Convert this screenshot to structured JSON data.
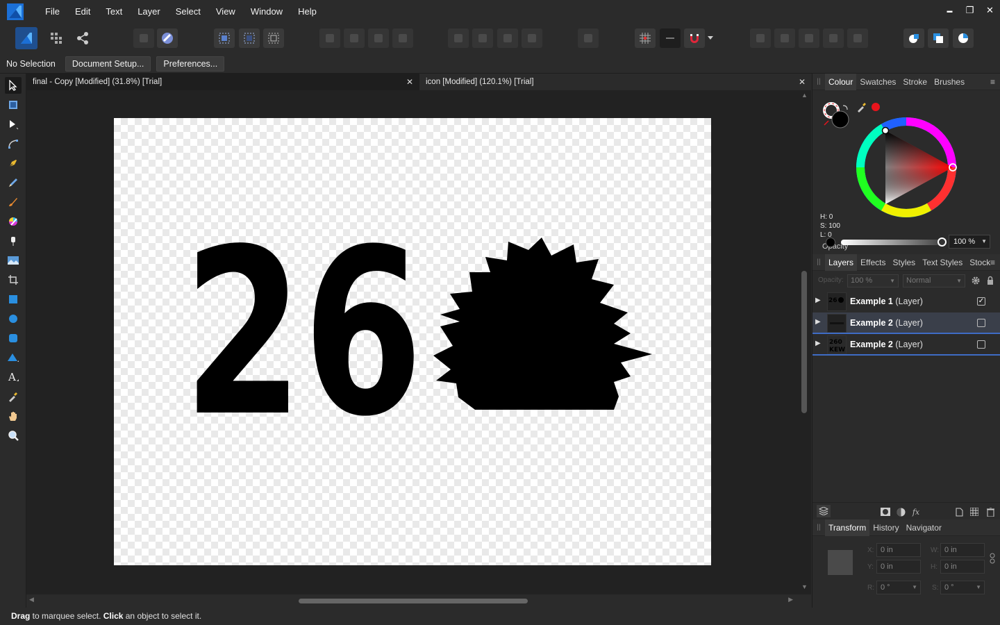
{
  "menu": [
    "File",
    "Edit",
    "Text",
    "Layer",
    "Select",
    "View",
    "Window",
    "Help"
  ],
  "window_controls": {
    "minimize": "▬",
    "restore": "❐",
    "close": "✕"
  },
  "context": {
    "selection": "No Selection",
    "document_setup": "Document Setup...",
    "preferences": "Preferences..."
  },
  "tabs": [
    {
      "title": "final - Copy [Modified] (31.8%) [Trial]",
      "close": "✕"
    },
    {
      "title": "icon [Modified] (120.1%) [Trial]",
      "close": "✕"
    }
  ],
  "canvas": {
    "text": "26"
  },
  "status": {
    "drag": "Drag",
    "drag_desc": " to marquee select. ",
    "click": "Click",
    "click_desc": " an object to select it."
  },
  "colour_panel": {
    "tabs": [
      "Colour",
      "Swatches",
      "Stroke",
      "Brushes"
    ],
    "h": "H: 0",
    "s": "S: 100",
    "l": "L: 0",
    "opacity_label": "Opacity",
    "opacity_value": "100 %",
    "accent": "#e8141c"
  },
  "layers_panel": {
    "tabs": [
      "Layers",
      "Effects",
      "Styles",
      "Text Styles",
      "Stock"
    ],
    "opacity_label": "Opacity:",
    "opacity_value": "100 %",
    "blend_mode": "Normal",
    "layers": [
      {
        "name": "Example 1",
        "type": "(Layer)",
        "checked": "✓"
      },
      {
        "name": "Example 2",
        "type": "(Layer)",
        "checked": ""
      },
      {
        "name": "Example 2",
        "type": "(Layer)",
        "checked": ""
      }
    ]
  },
  "transform_panel": {
    "tabs": [
      "Transform",
      "History",
      "Navigator"
    ],
    "x_label": "X:",
    "x": "0 in",
    "y_label": "Y:",
    "y": "0 in",
    "w_label": "W:",
    "w": "0 in",
    "h_label": "H:",
    "h": "0 in",
    "r_label": "R:",
    "r": "0 °",
    "s_label": "S:",
    "s": "0 °"
  }
}
